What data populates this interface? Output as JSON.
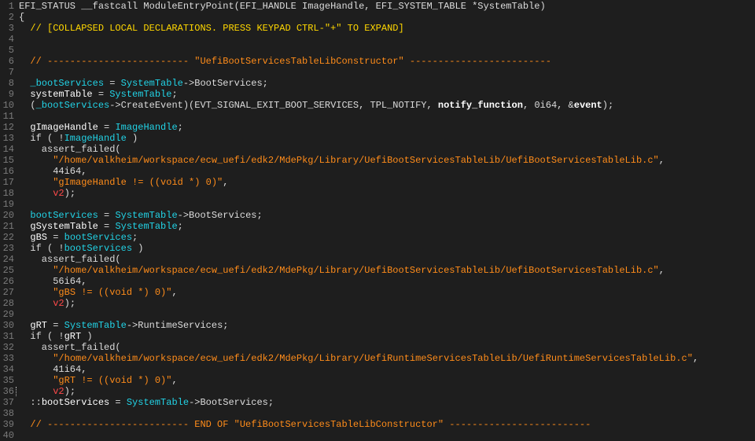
{
  "editor": {
    "lines": [
      {
        "n": "1",
        "tokens": [
          {
            "t": "EFI_STATUS __fastcall ModuleEntryPoint(EFI_HANDLE ImageHandle, EFI_SYSTEM_TABLE *SystemTable)",
            "c": "plain"
          }
        ]
      },
      {
        "n": "2",
        "tokens": [
          {
            "t": "{",
            "c": "plain"
          }
        ]
      },
      {
        "n": "3",
        "tokens": [
          {
            "t": "  // [COLLAPSED LOCAL DECLARATIONS. PRESS KEYPAD CTRL-\"+\" TO EXPAND]",
            "c": "collapsed"
          }
        ]
      },
      {
        "n": "4",
        "tokens": []
      },
      {
        "n": "5",
        "tokens": []
      },
      {
        "n": "6",
        "tokens": [
          {
            "t": "  // ------------------------- \"UefiBootServicesTableLibConstructor\" -------------------------",
            "c": "comment"
          }
        ]
      },
      {
        "n": "7",
        "tokens": []
      },
      {
        "n": "8",
        "tokens": [
          {
            "t": "  ",
            "c": "plain"
          },
          {
            "t": "_bootServices",
            "c": "global"
          },
          {
            "t": " = ",
            "c": "plain"
          },
          {
            "t": "SystemTable",
            "c": "param"
          },
          {
            "t": "->BootServices;",
            "c": "plain"
          }
        ]
      },
      {
        "n": "9",
        "tokens": [
          {
            "t": "  ",
            "c": "plain"
          },
          {
            "t": "systemTable",
            "c": "local"
          },
          {
            "t": " = ",
            "c": "plain"
          },
          {
            "t": "SystemTable",
            "c": "param"
          },
          {
            "t": ";",
            "c": "plain"
          }
        ]
      },
      {
        "n": "10",
        "tokens": [
          {
            "t": "  (",
            "c": "plain"
          },
          {
            "t": "_bootServices",
            "c": "global"
          },
          {
            "t": "->CreateEvent)(EVT_SIGNAL_EXIT_BOOT_SERVICES, TPL_NOTIFY, ",
            "c": "plain"
          },
          {
            "t": "notify_function",
            "c": "bold"
          },
          {
            "t": ", 0i64, &",
            "c": "plain"
          },
          {
            "t": "event",
            "c": "bold"
          },
          {
            "t": ");",
            "c": "plain"
          }
        ]
      },
      {
        "n": "11",
        "tokens": []
      },
      {
        "n": "12",
        "tokens": [
          {
            "t": "  ",
            "c": "plain"
          },
          {
            "t": "gImageHandle",
            "c": "local"
          },
          {
            "t": " = ",
            "c": "plain"
          },
          {
            "t": "ImageHandle",
            "c": "param"
          },
          {
            "t": ";",
            "c": "plain"
          }
        ]
      },
      {
        "n": "13",
        "tokens": [
          {
            "t": "  if ( !",
            "c": "plain"
          },
          {
            "t": "ImageHandle",
            "c": "param"
          },
          {
            "t": " )",
            "c": "plain"
          }
        ]
      },
      {
        "n": "14",
        "tokens": [
          {
            "t": "    assert_failed(",
            "c": "plain"
          }
        ]
      },
      {
        "n": "15",
        "tokens": [
          {
            "t": "      ",
            "c": "plain"
          },
          {
            "t": "\"/home/valkheim/workspace/ecw_uefi/edk2/MdePkg/Library/UefiBootServicesTableLib/UefiBootServicesTableLib.c\"",
            "c": "string"
          },
          {
            "t": ",",
            "c": "plain"
          }
        ]
      },
      {
        "n": "16",
        "tokens": [
          {
            "t": "      44i64,",
            "c": "plain"
          }
        ]
      },
      {
        "n": "17",
        "tokens": [
          {
            "t": "      ",
            "c": "plain"
          },
          {
            "t": "\"gImageHandle != ((void *) 0)\"",
            "c": "string"
          },
          {
            "t": ",",
            "c": "plain"
          }
        ]
      },
      {
        "n": "18",
        "tokens": [
          {
            "t": "      ",
            "c": "plain"
          },
          {
            "t": "v2",
            "c": "reg"
          },
          {
            "t": ");",
            "c": "plain"
          }
        ]
      },
      {
        "n": "19",
        "tokens": []
      },
      {
        "n": "20",
        "tokens": [
          {
            "t": "  ",
            "c": "plain"
          },
          {
            "t": "bootServices",
            "c": "global"
          },
          {
            "t": " = ",
            "c": "plain"
          },
          {
            "t": "SystemTable",
            "c": "param"
          },
          {
            "t": "->BootServices;",
            "c": "plain"
          }
        ]
      },
      {
        "n": "21",
        "tokens": [
          {
            "t": "  ",
            "c": "plain"
          },
          {
            "t": "gSystemTable",
            "c": "local"
          },
          {
            "t": " = ",
            "c": "plain"
          },
          {
            "t": "SystemTable",
            "c": "param"
          },
          {
            "t": ";",
            "c": "plain"
          }
        ]
      },
      {
        "n": "22",
        "tokens": [
          {
            "t": "  ",
            "c": "plain"
          },
          {
            "t": "gBS",
            "c": "local"
          },
          {
            "t": " = ",
            "c": "plain"
          },
          {
            "t": "bootServices",
            "c": "global"
          },
          {
            "t": ";",
            "c": "plain"
          }
        ]
      },
      {
        "n": "23",
        "tokens": [
          {
            "t": "  if ( !",
            "c": "plain"
          },
          {
            "t": "bootServices",
            "c": "global"
          },
          {
            "t": " )",
            "c": "plain"
          }
        ]
      },
      {
        "n": "24",
        "tokens": [
          {
            "t": "    assert_failed(",
            "c": "plain"
          }
        ]
      },
      {
        "n": "25",
        "tokens": [
          {
            "t": "      ",
            "c": "plain"
          },
          {
            "t": "\"/home/valkheim/workspace/ecw_uefi/edk2/MdePkg/Library/UefiBootServicesTableLib/UefiBootServicesTableLib.c\"",
            "c": "string"
          },
          {
            "t": ",",
            "c": "plain"
          }
        ]
      },
      {
        "n": "26",
        "tokens": [
          {
            "t": "      56i64,",
            "c": "plain"
          }
        ]
      },
      {
        "n": "27",
        "tokens": [
          {
            "t": "      ",
            "c": "plain"
          },
          {
            "t": "\"gBS != ((void *) 0)\"",
            "c": "string"
          },
          {
            "t": ",",
            "c": "plain"
          }
        ]
      },
      {
        "n": "28",
        "tokens": [
          {
            "t": "      ",
            "c": "plain"
          },
          {
            "t": "v2",
            "c": "reg"
          },
          {
            "t": ");",
            "c": "plain"
          }
        ]
      },
      {
        "n": "29",
        "tokens": []
      },
      {
        "n": "30",
        "tokens": [
          {
            "t": "  ",
            "c": "plain"
          },
          {
            "t": "gRT",
            "c": "local"
          },
          {
            "t": " = ",
            "c": "plain"
          },
          {
            "t": "SystemTable",
            "c": "param"
          },
          {
            "t": "->RuntimeServices;",
            "c": "plain"
          }
        ]
      },
      {
        "n": "31",
        "tokens": [
          {
            "t": "  if ( !",
            "c": "plain"
          },
          {
            "t": "gRT",
            "c": "local"
          },
          {
            "t": " )",
            "c": "plain"
          }
        ]
      },
      {
        "n": "32",
        "tokens": [
          {
            "t": "    assert_failed(",
            "c": "plain"
          }
        ]
      },
      {
        "n": "33",
        "tokens": [
          {
            "t": "      ",
            "c": "plain"
          },
          {
            "t": "\"/home/valkheim/workspace/ecw_uefi/edk2/MdePkg/Library/UefiRuntimeServicesTableLib/UefiRuntimeServicesTableLib.c\"",
            "c": "string"
          },
          {
            "t": ",",
            "c": "plain"
          }
        ]
      },
      {
        "n": "34",
        "tokens": [
          {
            "t": "      41i64,",
            "c": "plain"
          }
        ]
      },
      {
        "n": "35",
        "tokens": [
          {
            "t": "      ",
            "c": "plain"
          },
          {
            "t": "\"gRT != ((void *) 0)\"",
            "c": "string"
          },
          {
            "t": ",",
            "c": "plain"
          }
        ]
      },
      {
        "n": "36",
        "marker": true,
        "tokens": [
          {
            "t": "      ",
            "c": "plain"
          },
          {
            "t": "v2",
            "c": "reg"
          },
          {
            "t": ");",
            "c": "plain"
          }
        ]
      },
      {
        "n": "37",
        "tokens": [
          {
            "t": "  ::",
            "c": "plain"
          },
          {
            "t": "bootServices",
            "c": "local"
          },
          {
            "t": " = ",
            "c": "plain"
          },
          {
            "t": "SystemTable",
            "c": "param"
          },
          {
            "t": "->BootServices;",
            "c": "plain"
          }
        ]
      },
      {
        "n": "38",
        "tokens": []
      },
      {
        "n": "39",
        "tokens": [
          {
            "t": "  // ------------------------- END OF \"UefiBootServicesTableLibConstructor\" -------------------------",
            "c": "comment"
          }
        ]
      },
      {
        "n": "40",
        "tokens": []
      }
    ]
  },
  "theme": {
    "background": "#1e1e1e",
    "line_number": "#7a7a7a",
    "plain": "#dcdcdc",
    "global": "#22d3e6",
    "param": "#22d3e6",
    "local": "#ffffff",
    "string": "#ff8c1a",
    "comment": "#ff8c1a",
    "collapsed": "#ffd700",
    "register": "#ff4a4a"
  }
}
